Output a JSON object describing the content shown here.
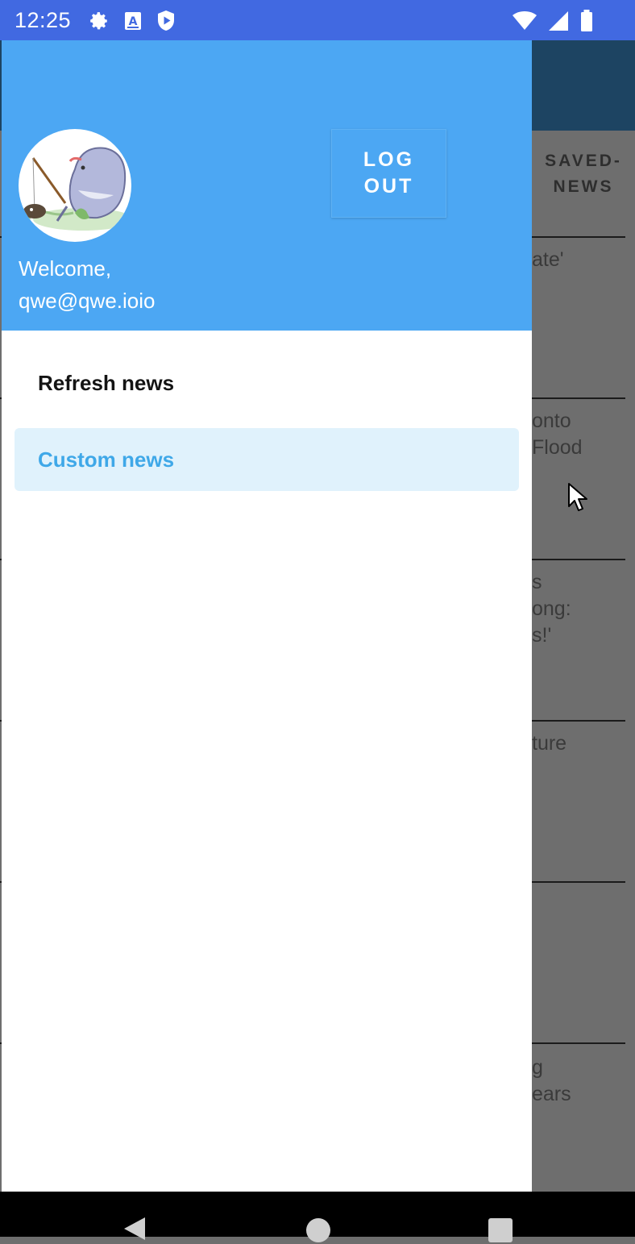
{
  "status_bar": {
    "time": "12:25",
    "icons_left": [
      "gear-icon",
      "a-keyboard-icon",
      "shield-play-icon"
    ],
    "icons_right": [
      "wifi-icon",
      "cell-signal-icon",
      "battery-icon"
    ],
    "color": "#4169e1"
  },
  "background_screen": {
    "tab_label": "SAVED-\nNEWS",
    "snippets": [
      "ate'",
      "onto\nFlood",
      "s\nong:\ns!'",
      "ture",
      "g\nears"
    ]
  },
  "drawer": {
    "header_color": "#4ca7f3",
    "avatar": "shark-fishing-avatar",
    "welcome_line1": "Welcome,",
    "welcome_line2": "qwe@qwe.ioio",
    "logout_label": "LOG OUT",
    "menu": [
      {
        "label": "Refresh news",
        "selected": false
      },
      {
        "label": "Custom news",
        "selected": true
      }
    ],
    "selected_color": "#3fa8e8"
  },
  "nav_bar": {
    "buttons": [
      "back-icon",
      "home-icon",
      "recents-icon"
    ]
  }
}
